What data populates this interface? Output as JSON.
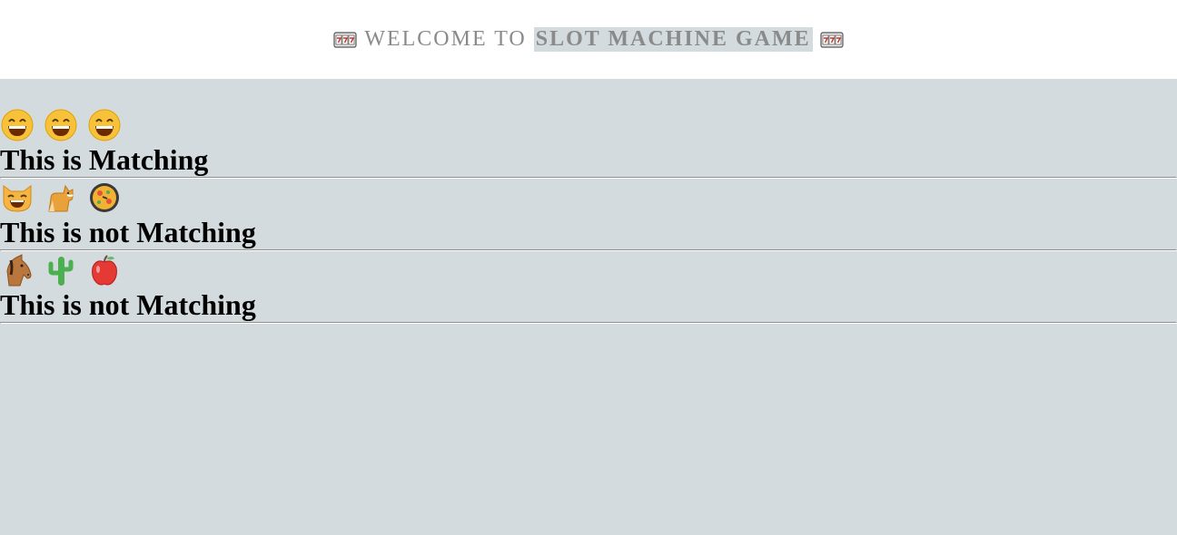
{
  "header": {
    "prefix": "WELCOME TO",
    "highlight": "SLOT MACHINE GAME",
    "left_icon": "slot-machine-icon",
    "right_icon": "slot-machine-icon"
  },
  "rows": [
    {
      "emojis": [
        "grinning-face-icon",
        "grinning-face-icon",
        "grinning-face-icon"
      ],
      "result": "This is Matching"
    },
    {
      "emojis": [
        "grinning-cat-icon",
        "shiba-dog-icon",
        "paella-icon"
      ],
      "result": "This is not Matching"
    },
    {
      "emojis": [
        "horse-face-icon",
        "cactus-icon",
        "red-apple-icon"
      ],
      "result": "This is not Matching"
    }
  ],
  "colors": {
    "background": "#d3dbde",
    "header_text": "#8a8a8a"
  }
}
